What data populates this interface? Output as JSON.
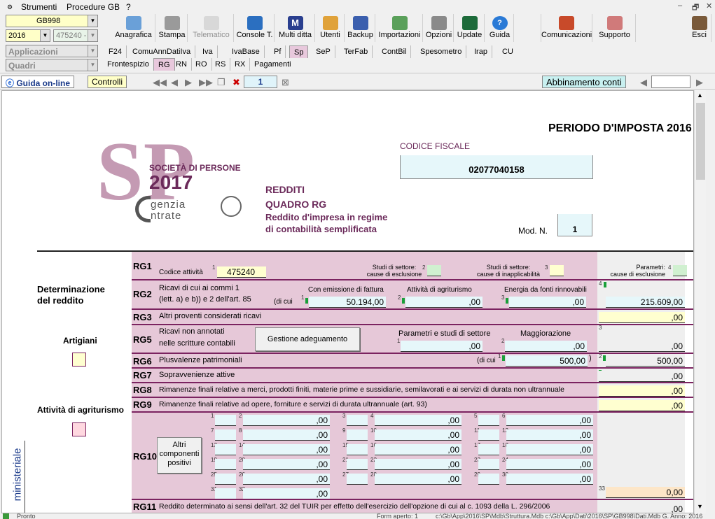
{
  "menu": {
    "items": [
      "Strumenti",
      "Procedure GB",
      "?"
    ]
  },
  "window_controls": [
    "–",
    "🗗",
    "✕"
  ],
  "selectors": {
    "company": "GB998",
    "year": "2016",
    "code": "475240 -",
    "applicazioni": "Applicazioni",
    "quadri": "Quadri"
  },
  "toolbar": {
    "buttons": [
      "Anagrafica",
      "Stampa",
      "Telematico",
      "Console T.",
      "Multi ditta",
      "Utenti",
      "Backup",
      "Importazioni",
      "Opzioni",
      "Update",
      "Guida",
      "Comunicazioni",
      "Supporto",
      "Esci"
    ]
  },
  "tabs1": [
    "F24",
    "ComuAnnDatiIva",
    "Iva",
    "IvaBase",
    "Pf",
    "Sp",
    "SeP",
    "TerFab",
    "ContBil",
    "Spesometro",
    "Irap",
    "CU"
  ],
  "tabs2": [
    "Frontespizio",
    "RG",
    "RN",
    "RO",
    "RS",
    "RX",
    "Pagamenti"
  ],
  "nav": {
    "guida": "Guida on-line",
    "controlli": "Controlli",
    "page": "1",
    "abbinamento": "Abbinamento conti"
  },
  "form": {
    "period": "PERIODO D'IMPOSTA 2016",
    "codice_fiscale_label": "CODICE FISCALE",
    "codice_fiscale": "02077040158",
    "logo_sp": "SP",
    "logo_soc": "SOCIETÀ DI PERSONE",
    "logo_year": "2017",
    "logo_agenzia": "genzia",
    "logo_entrate": "ntrate",
    "redditi": "REDDITI",
    "quadro": "QUADRO RG",
    "desc1": "Reddito d'impresa in regime",
    "desc2": "di contabilità semplificata",
    "mod_label": "Mod. N.",
    "mod_value": "1",
    "side": {
      "determinazione": "Determinazione",
      "del_reddito": "del reddito",
      "artigiani": "Artigiani",
      "agriturismo": "Attività di agriturismo",
      "ministeriale": "ministeriale"
    },
    "rg1": {
      "code": "RG1",
      "label": "Codice attività",
      "value": "475240",
      "studi1a": "Studi di settore:",
      "studi1b": "cause di esclusione",
      "studi2a": "Studi di settore:",
      "studi2b": "cause di inapplicabilità",
      "param1": "Parametri:",
      "param2": "cause di esclusione"
    },
    "rg2": {
      "code": "RG2",
      "l1": "Ricavi di cui ai commi 1",
      "l2": "(lett. a) e b)) e 2 dell'art. 85",
      "dicui": "(di cui",
      "h1": "Con emissione di fattura",
      "h2": "Attività di agriturismo",
      "h3": "Energia da fonti rinnovabili",
      "v1": "50.194",
      "v2": "",
      "v3": "",
      "v4": "215.609"
    },
    "rg3": {
      "code": "RG3",
      "label": "Altri proventi considerati ricavi"
    },
    "rg5": {
      "code": "RG5",
      "l1": "Ricavi non annotati",
      "l2": "nelle scritture contabili",
      "btn": "Gestione adeguamento",
      "h1": "Parametri e studi di settore",
      "h2": "Maggiorazione"
    },
    "rg6": {
      "code": "RG6",
      "label": "Plusvalenze patrimoniali",
      "dicui": "(di cui",
      "v1": "500",
      "v2": "500"
    },
    "rg7": {
      "code": "RG7",
      "label": "Sopravvenienze attive"
    },
    "rg8": {
      "code": "RG8",
      "label": "Rimanenze finali relative a merci, prodotti finiti, materie prime e sussidiarie, semilavorati e ai servizi di durata non ultrannuale"
    },
    "rg9": {
      "code": "RG9",
      "label": "Rimanenze finali relative ad opere, forniture e servizi di durata ultrannuale (art. 93)"
    },
    "rg10": {
      "code": "RG10",
      "btn1": "Altri",
      "btn2": "componenti",
      "btn3": "positivi",
      "total": "0"
    },
    "rg11": {
      "code": "RG11",
      "label": "Reddito determinato ai sensi dell'art. 32 del TUIR per effetto dell'esercizio dell'opzione di cui al c. 1093 della L. 296/2006"
    },
    "dec": ",00"
  },
  "status": {
    "ready": "Pronto",
    "form": "Form aperto: 1",
    "path": "c:\\Gb\\App\\2016\\SP\\Mdb\\Struttura.Mdb c:\\Gb\\App\\Dati\\2016\\SP\\GB998\\Dati.Mdb G. Anno: 2016"
  }
}
